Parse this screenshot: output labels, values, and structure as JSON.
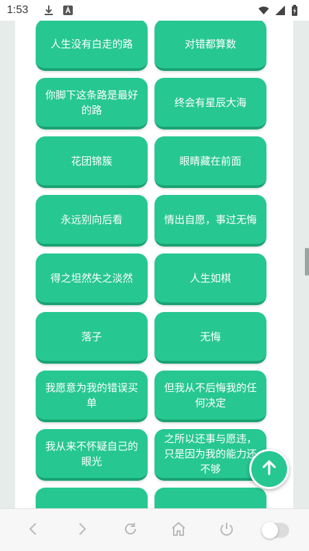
{
  "status_bar": {
    "time": "1:53",
    "icons": [
      "download-icon",
      "a-badge-icon",
      "wifi-icon",
      "signal-icon",
      "battery-icon"
    ]
  },
  "cards": [
    "人生没有白走的路",
    "对错都算数",
    "你脚下这条路是最好的路",
    "终会有星辰大海",
    "花团锦簇",
    "眼睛藏在前面",
    "永远别向后看",
    "情出自愿，事过无悔",
    "得之坦然失之淡然",
    "人生如棋",
    "落子",
    "无悔",
    "我愿意为我的错误买单",
    "但我从不后悔我的任何决定",
    "我从来不怀疑自己的眼光",
    "之所以还事与愿违，只是因为我的能力还不够",
    "",
    ""
  ],
  "fab": {
    "icon": "arrow-up-icon"
  },
  "bottom_nav": {
    "icons": [
      "back-icon",
      "forward-icon",
      "refresh-icon",
      "home-icon",
      "power-icon",
      "toggle-switch"
    ]
  },
  "colors": {
    "card": "#27c791",
    "card_shadow": "#1aa372",
    "nav_icon": "#b8b8b8"
  }
}
